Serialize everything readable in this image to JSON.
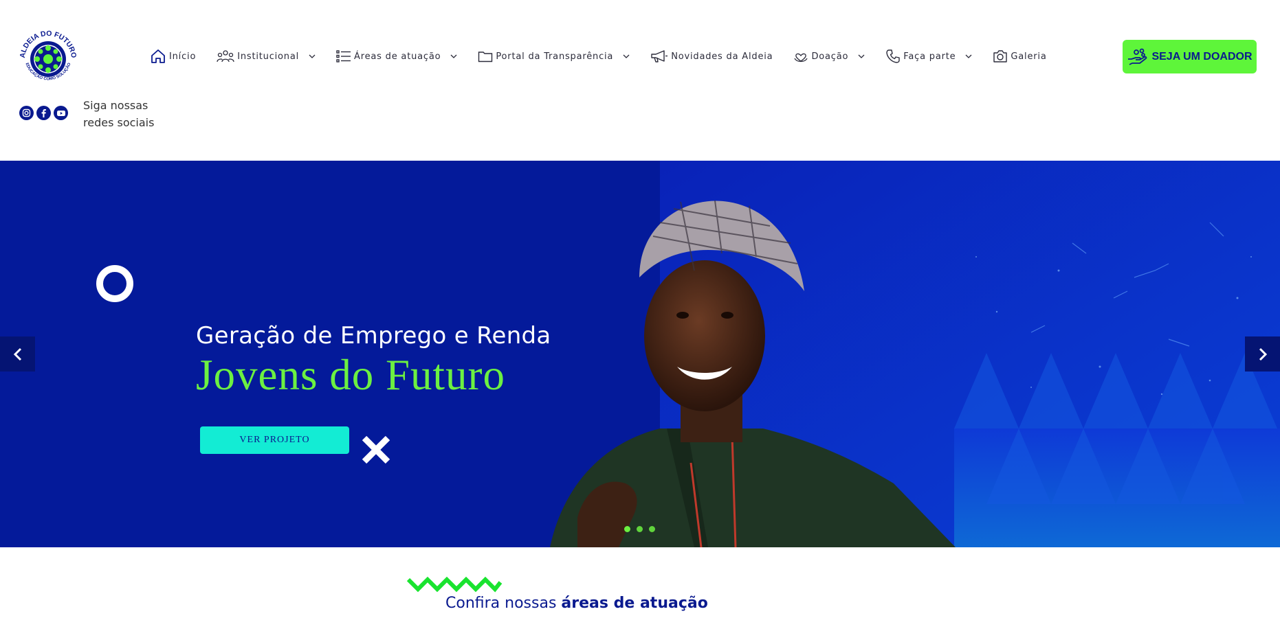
{
  "brand": {
    "name": "ALDEIA DO FUTURO",
    "tagline": "EDUCAÇÃO COMO SOLUÇÃO",
    "colors": {
      "primary": "#0a1a8f",
      "accent_green": "#5ef53a",
      "accent_cyan": "#13ecd4",
      "hero_bg": "#041a9a"
    }
  },
  "social": {
    "label": "Siga nossas redes sociais",
    "icons": [
      "instagram-icon",
      "facebook-icon",
      "youtube-icon"
    ]
  },
  "nav": {
    "items": [
      {
        "label": "Início",
        "icon": "home-icon",
        "dropdown": false
      },
      {
        "label": "Institucional",
        "icon": "people-icon",
        "dropdown": true
      },
      {
        "label": "Áreas de atuação",
        "icon": "list-icon",
        "dropdown": true
      },
      {
        "label": "Portal da Transparência",
        "icon": "folder-icon",
        "dropdown": true
      },
      {
        "label": "Novidades da Aldeia",
        "icon": "megaphone-icon",
        "dropdown": false
      },
      {
        "label": "Doação",
        "icon": "heart-hand-icon",
        "dropdown": true
      },
      {
        "label": "Faça parte",
        "icon": "phone-icon",
        "dropdown": true
      },
      {
        "label": "Galeria",
        "icon": "camera-icon",
        "dropdown": false
      }
    ]
  },
  "cta": {
    "label": "SEJA UM DOADOR",
    "icon": "donate-hand-icon"
  },
  "hero": {
    "subtitle": "Geração de Emprego e Renda",
    "title": "Jovens do Futuro",
    "button": "VER PROJETO",
    "slides": 3,
    "active_slide": 1
  },
  "section": {
    "prefix": "Confira nossas ",
    "highlight": "áreas de atuação"
  }
}
